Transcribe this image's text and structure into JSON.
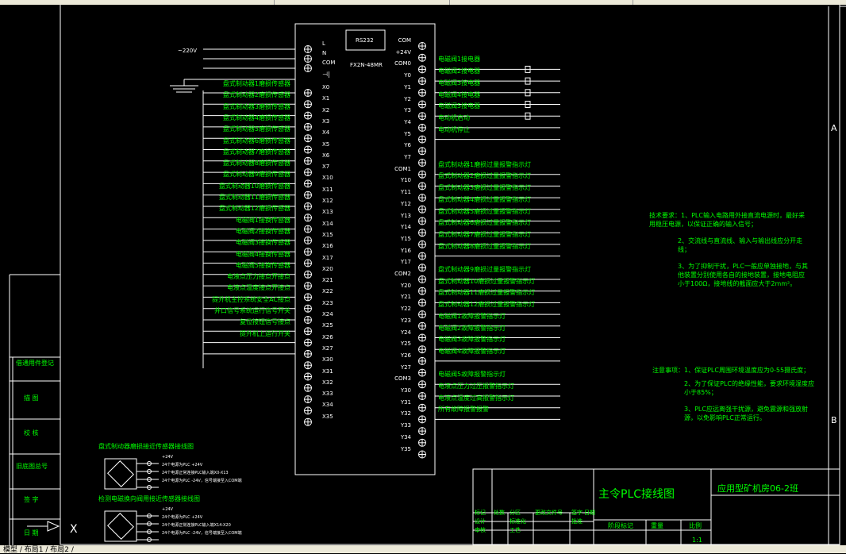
{
  "colors": {
    "background": "#000000",
    "line": "#ffffff",
    "accent": "#00ff00"
  },
  "plc": {
    "model": "FX2N-48MR",
    "port": "RS232"
  },
  "power": {
    "supply_label": "~220V",
    "terminals": [
      "L",
      "N",
      "COM"
    ]
  },
  "inputs": [
    {
      "terminal": "X0",
      "label": "盘式制动器1磨损传感器"
    },
    {
      "terminal": "X1",
      "label": "盘式制动器2磨损传感器"
    },
    {
      "terminal": "X2",
      "label": "盘式制动器3磨损传感器"
    },
    {
      "terminal": "X3",
      "label": "盘式制动器4磨损传感器"
    },
    {
      "terminal": "X4",
      "label": "盘式制动器5磨损传感器"
    },
    {
      "terminal": "X5",
      "label": "盘式制动器6磨损传感器"
    },
    {
      "terminal": "X6",
      "label": "盘式制动器7磨损传感器"
    },
    {
      "terminal": "X7",
      "label": "盘式制动器8磨损传感器"
    },
    {
      "terminal": "X10",
      "label": "盘式制动器9磨损传感器"
    },
    {
      "terminal": "X11",
      "label": "盘式制动器10磨损传感器"
    },
    {
      "terminal": "X12",
      "label": "盘式制动器11磨损传感器"
    },
    {
      "terminal": "X13",
      "label": "盘式制动器12磨损传感器"
    },
    {
      "terminal": "X14",
      "label": "电磁阀1接换传感器"
    },
    {
      "terminal": "X15",
      "label": "电磁阀2接换传感器"
    },
    {
      "terminal": "X16",
      "label": "电磁阀3接换传感器"
    },
    {
      "terminal": "X17",
      "label": "电磁阀4接换传感器"
    },
    {
      "terminal": "X20",
      "label": "电磁阀5接换传感器"
    },
    {
      "terminal": "X21",
      "label": "电液点压力接点开接点"
    },
    {
      "terminal": "X22",
      "label": "电液点温度接点开接点"
    },
    {
      "terminal": "X23",
      "label": "提升机主控系统安全AC接点"
    },
    {
      "terminal": "X24",
      "label": "井口信号系统运行信号开关"
    },
    {
      "terminal": "X25",
      "label": "复位按钮信号接点"
    },
    {
      "terminal": "X26",
      "label": "提升机上运行开关"
    },
    {
      "terminal": "X27",
      "label": ""
    },
    {
      "terminal": "X30",
      "label": ""
    },
    {
      "terminal": "X31",
      "label": ""
    },
    {
      "terminal": "X32",
      "label": ""
    },
    {
      "terminal": "X33",
      "label": ""
    },
    {
      "terminal": "X34",
      "label": ""
    },
    {
      "terminal": "X35",
      "label": ""
    }
  ],
  "outputs": [
    {
      "terminal": "COM",
      "label": ""
    },
    {
      "terminal": "+24V",
      "label": ""
    },
    {
      "terminal": "COM0",
      "label": "电磁阀1接电器"
    },
    {
      "terminal": "Y0",
      "label": "电磁阀2接电器"
    },
    {
      "terminal": "Y1",
      "label": "电磁阀3接电器"
    },
    {
      "terminal": "Y2",
      "label": "电磁阀4接电器"
    },
    {
      "terminal": "Y3",
      "label": "电磁阀5接电器"
    },
    {
      "terminal": "Y4",
      "label": "电动机启动"
    },
    {
      "terminal": "Y5",
      "label": "电动机停止"
    },
    {
      "terminal": "Y6",
      "label": ""
    },
    {
      "terminal": "Y7",
      "label": ""
    },
    {
      "terminal": "COM1",
      "label": "盘式制动器1磨损过量报警指示灯"
    },
    {
      "terminal": "Y10",
      "label": "盘式制动器2磨损过量报警指示灯"
    },
    {
      "terminal": "Y11",
      "label": "盘式制动器3磨损过量报警指示灯"
    },
    {
      "terminal": "Y12",
      "label": "盘式制动器4磨损过量报警指示灯"
    },
    {
      "terminal": "Y13",
      "label": "盘式制动器5磨损过量报警指示灯"
    },
    {
      "terminal": "Y14",
      "label": "盘式制动器6磨损过量报警指示灯"
    },
    {
      "terminal": "Y15",
      "label": "盘式制动器7磨损过量报警指示灯"
    },
    {
      "terminal": "Y16",
      "label": "盘式制动器8磨损过量报警指示灯"
    },
    {
      "terminal": "Y17",
      "label": ""
    },
    {
      "terminal": "COM2",
      "label": "盘式制动器9磨损过量报警指示灯"
    },
    {
      "terminal": "Y20",
      "label": "盘式制动器10磨损过量报警指示灯"
    },
    {
      "terminal": "Y21",
      "label": "盘式制动器11磨损过量报警指示灯"
    },
    {
      "terminal": "Y22",
      "label": "盘式制动器12磨损过量报警指示灯"
    },
    {
      "terminal": "Y23",
      "label": "电磁阀1故障报警指示灯"
    },
    {
      "terminal": "Y24",
      "label": "电磁阀2故障报警指示灯"
    },
    {
      "terminal": "Y25",
      "label": "电磁阀3故障报警指示灯"
    },
    {
      "terminal": "Y26",
      "label": "电磁阀4故障报警指示灯"
    },
    {
      "terminal": "Y27",
      "label": ""
    },
    {
      "terminal": "COM3",
      "label": "电磁阀5故障报警指示灯"
    },
    {
      "terminal": "Y30",
      "label": "电液点压力过压报警指示灯"
    },
    {
      "terminal": "Y31",
      "label": "电液点温度过高报警指示灯"
    },
    {
      "terminal": "Y32",
      "label": "所有故障报警报警"
    },
    {
      "terminal": "Y33",
      "label": ""
    },
    {
      "terminal": "Y34",
      "label": ""
    },
    {
      "terminal": "Y35",
      "label": ""
    }
  ],
  "notes": {
    "tech_title": "技术要求：",
    "tech_items": [
      "1、PLC输入电路用外接直流电源时，最好采用稳压电源，以保证正确的输入信号；",
      "2、交流线与直流线、输入与输出线应分开走线；",
      "3、为了抑制干扰，PLC一般应单独接地，与其他装置分别使用各自的接地装置，接地电阻应小于100Ω，接地线的截面应大于2mm²。"
    ],
    "caution_title": "注意事项：",
    "caution_items": [
      "1、保证PLC周围环境温度应为0-55摄氏度；",
      "2、为了保证PLC的绝缘性能，要求环境湿度应小于85%；",
      "3、PLC应远离强干扰源，避免震源和强放射源，以免影响PLC正常运行。"
    ]
  },
  "sensor_diagrams": [
    {
      "title": "盘式制动器磨损接近传感器接线图",
      "wires": [
        "+24V",
        "24个电源为PLC +24V",
        "24个电源正常连接PLC输入端X0-X13",
        "24个电源为PLC -24V，信号端接至入COM端"
      ]
    },
    {
      "title": "检测电磁换向阀用接近传感器接线图",
      "wires": [
        "+24V",
        "24个电源为PLC +24V",
        "24个电源正常连接PLC输入端X14-X20",
        "24个电源为PLC -24V，信号端接至入COM端"
      ]
    }
  ],
  "left_labels": [
    "借通用件登记",
    "描 图",
    "校 核",
    "旧底图总号",
    "签 字",
    "日 期"
  ],
  "title_block": {
    "drawing_title": "主令PLC接线图",
    "project": "应用型矿机房06-2班",
    "row_labels": [
      "标记",
      "处数",
      "分区",
      "更改文件号",
      "签字",
      "日期"
    ],
    "row2": [
      "设计",
      "",
      "标准化",
      "",
      "批准",
      ""
    ],
    "row3": [
      "审核",
      "",
      "工艺",
      "",
      "",
      ""
    ],
    "stage_label": "阶段标记",
    "weight_label": "重量",
    "scale_label": "比例",
    "scale_value": "1:1"
  },
  "border_markers": {
    "right": [
      "A",
      "B"
    ]
  },
  "app_tabs": [
    "模型",
    "布局1",
    "布局2"
  ]
}
